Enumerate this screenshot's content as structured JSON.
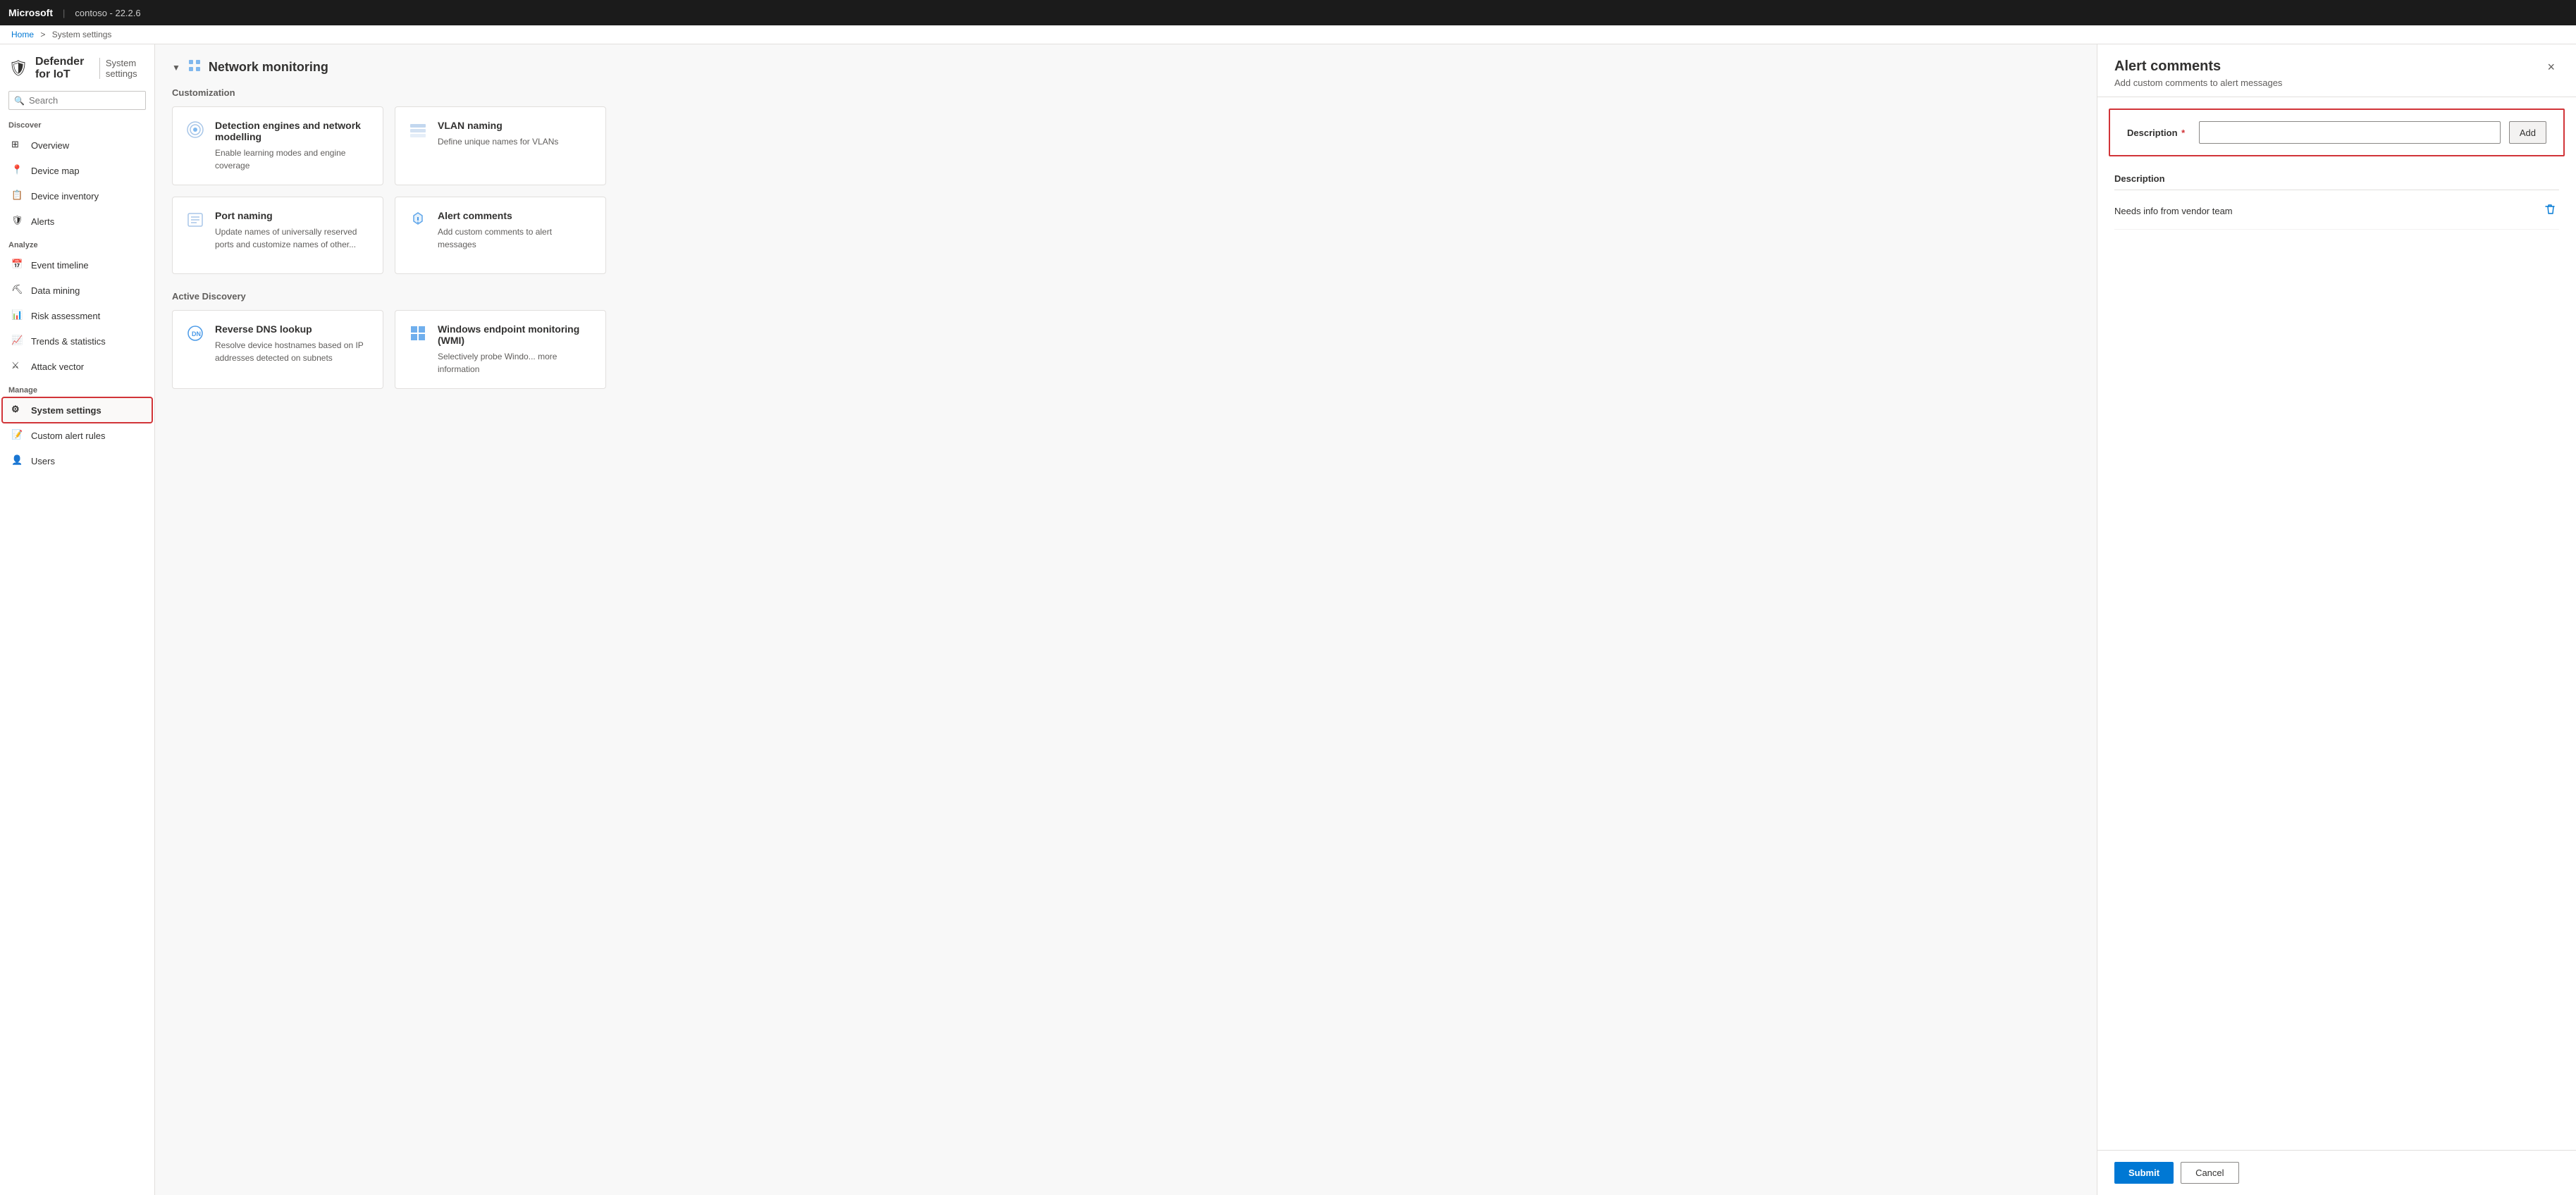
{
  "topbar": {
    "brand": "Microsoft",
    "separator": "|",
    "instance": "contoso - 22.2.6"
  },
  "breadcrumb": {
    "home": "Home",
    "separator": ">",
    "current": "System settings"
  },
  "sidebar": {
    "app_icon": "🛡",
    "app_name": "Defender for IoT",
    "page_title": "System settings",
    "search_placeholder": "Search",
    "collapse_icon": "«",
    "sections": [
      {
        "label": "Discover",
        "items": [
          {
            "id": "overview",
            "label": "Overview",
            "icon": "grid"
          },
          {
            "id": "device-map",
            "label": "Device map",
            "icon": "map"
          },
          {
            "id": "device-inventory",
            "label": "Device inventory",
            "icon": "list"
          },
          {
            "id": "alerts",
            "label": "Alerts",
            "icon": "shield"
          }
        ]
      },
      {
        "label": "Analyze",
        "items": [
          {
            "id": "event-timeline",
            "label": "Event timeline",
            "icon": "timeline"
          },
          {
            "id": "data-mining",
            "label": "Data mining",
            "icon": "mining"
          },
          {
            "id": "risk-assessment",
            "label": "Risk assessment",
            "icon": "risk"
          },
          {
            "id": "trends-statistics",
            "label": "Trends & statistics",
            "icon": "trends"
          },
          {
            "id": "attack-vector",
            "label": "Attack vector",
            "icon": "attack"
          }
        ]
      },
      {
        "label": "Manage",
        "items": [
          {
            "id": "system-settings",
            "label": "System settings",
            "icon": "settings",
            "active": true
          },
          {
            "id": "custom-alert-rules",
            "label": "Custom alert rules",
            "icon": "rules"
          },
          {
            "id": "users",
            "label": "Users",
            "icon": "users"
          }
        ]
      }
    ]
  },
  "content": {
    "section_title": "Network monitoring",
    "section_chevron": "▼",
    "subsections": [
      {
        "label": "Customization",
        "cards": [
          {
            "id": "detection-engines",
            "title": "Detection engines and network modelling",
            "description": "Enable learning modes and engine coverage"
          },
          {
            "id": "vlan-naming",
            "title": "VLAN naming",
            "description": "Define unique names for VLANs"
          },
          {
            "id": "port-naming",
            "title": "Port naming",
            "description": "Update names of universally reserved ports and customize names of other..."
          },
          {
            "id": "alert-comments",
            "title": "Alert comments",
            "description": "Add custom comments to alert messages"
          }
        ]
      },
      {
        "label": "Active Discovery",
        "cards": [
          {
            "id": "reverse-dns",
            "title": "Reverse DNS lookup",
            "description": "Resolve device hostnames based on IP addresses detected on subnets"
          },
          {
            "id": "windows-endpoint",
            "title": "Windows endpoint monitoring (WMI)",
            "description": "Selectively probe Windo... more information"
          }
        ]
      }
    ]
  },
  "panel": {
    "title": "Alert comments",
    "subtitle": "Add custom comments to alert messages",
    "close_label": "×",
    "form": {
      "description_label": "Description",
      "required_star": "*",
      "input_placeholder": "",
      "add_button_label": "Add"
    },
    "table": {
      "header": "Description",
      "rows": [
        {
          "id": 1,
          "description": "Needs info from vendor team"
        }
      ]
    },
    "footer": {
      "submit_label": "Submit",
      "cancel_label": "Cancel"
    }
  }
}
